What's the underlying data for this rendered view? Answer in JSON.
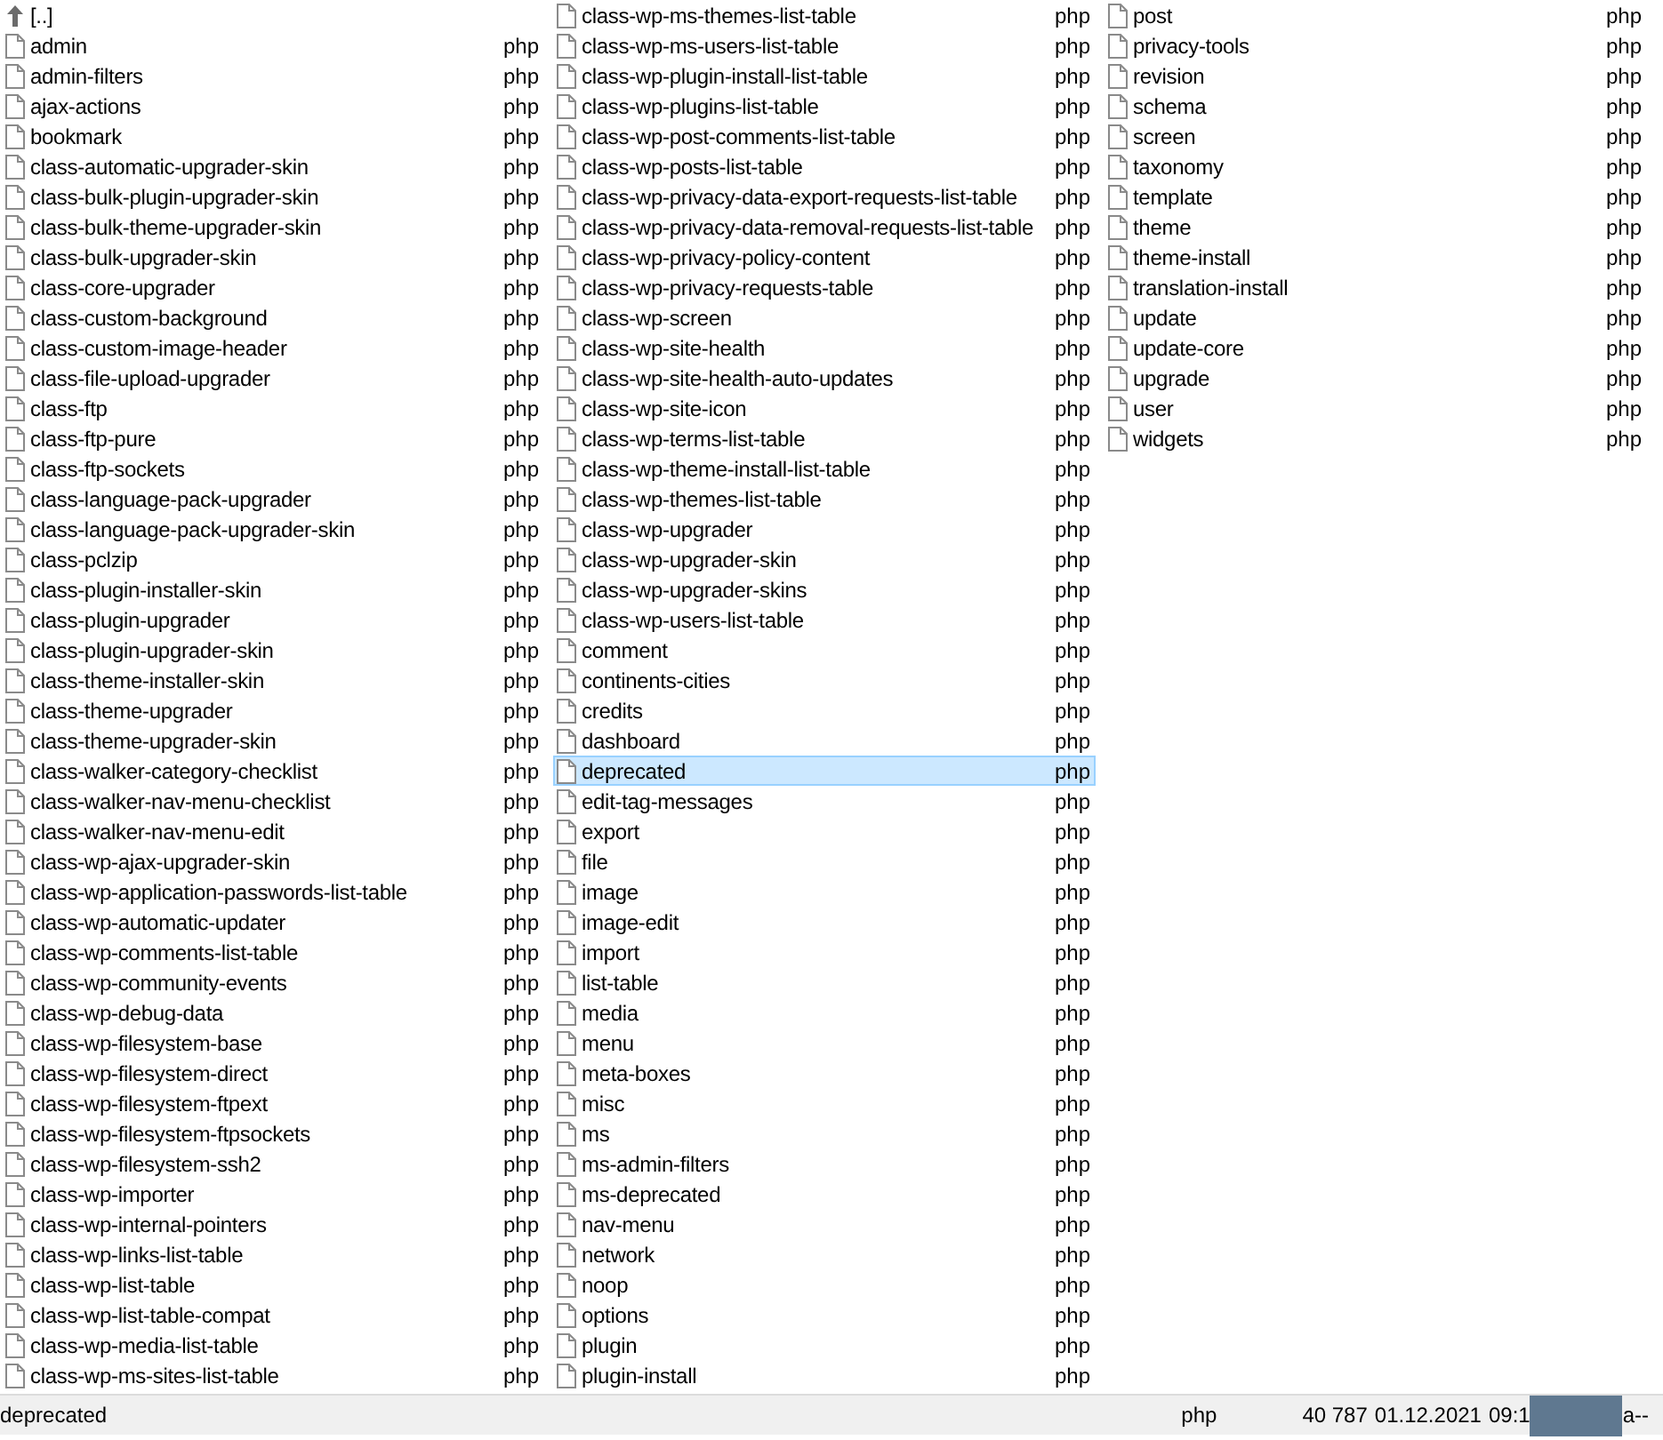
{
  "panel": {
    "columns": [
      {
        "items": [
          {
            "kind": "parent",
            "name": "[..]",
            "selected": false
          },
          {
            "kind": "file",
            "name": "admin",
            "ext": "php",
            "selected": false
          },
          {
            "kind": "file",
            "name": "admin-filters",
            "ext": "php",
            "selected": false
          },
          {
            "kind": "file",
            "name": "ajax-actions",
            "ext": "php",
            "selected": false
          },
          {
            "kind": "file",
            "name": "bookmark",
            "ext": "php",
            "selected": false
          },
          {
            "kind": "file",
            "name": "class-automatic-upgrader-skin",
            "ext": "php",
            "selected": false
          },
          {
            "kind": "file",
            "name": "class-bulk-plugin-upgrader-skin",
            "ext": "php",
            "selected": false
          },
          {
            "kind": "file",
            "name": "class-bulk-theme-upgrader-skin",
            "ext": "php",
            "selected": false
          },
          {
            "kind": "file",
            "name": "class-bulk-upgrader-skin",
            "ext": "php",
            "selected": false
          },
          {
            "kind": "file",
            "name": "class-core-upgrader",
            "ext": "php",
            "selected": false
          },
          {
            "kind": "file",
            "name": "class-custom-background",
            "ext": "php",
            "selected": false
          },
          {
            "kind": "file",
            "name": "class-custom-image-header",
            "ext": "php",
            "selected": false
          },
          {
            "kind": "file",
            "name": "class-file-upload-upgrader",
            "ext": "php",
            "selected": false
          },
          {
            "kind": "file",
            "name": "class-ftp",
            "ext": "php",
            "selected": false
          },
          {
            "kind": "file",
            "name": "class-ftp-pure",
            "ext": "php",
            "selected": false
          },
          {
            "kind": "file",
            "name": "class-ftp-sockets",
            "ext": "php",
            "selected": false
          },
          {
            "kind": "file",
            "name": "class-language-pack-upgrader",
            "ext": "php",
            "selected": false
          },
          {
            "kind": "file",
            "name": "class-language-pack-upgrader-skin",
            "ext": "php",
            "selected": false
          },
          {
            "kind": "file",
            "name": "class-pclzip",
            "ext": "php",
            "selected": false
          },
          {
            "kind": "file",
            "name": "class-plugin-installer-skin",
            "ext": "php",
            "selected": false
          },
          {
            "kind": "file",
            "name": "class-plugin-upgrader",
            "ext": "php",
            "selected": false
          },
          {
            "kind": "file",
            "name": "class-plugin-upgrader-skin",
            "ext": "php",
            "selected": false
          },
          {
            "kind": "file",
            "name": "class-theme-installer-skin",
            "ext": "php",
            "selected": false
          },
          {
            "kind": "file",
            "name": "class-theme-upgrader",
            "ext": "php",
            "selected": false
          },
          {
            "kind": "file",
            "name": "class-theme-upgrader-skin",
            "ext": "php",
            "selected": false
          },
          {
            "kind": "file",
            "name": "class-walker-category-checklist",
            "ext": "php",
            "selected": false
          },
          {
            "kind": "file",
            "name": "class-walker-nav-menu-checklist",
            "ext": "php",
            "selected": false
          },
          {
            "kind": "file",
            "name": "class-walker-nav-menu-edit",
            "ext": "php",
            "selected": false
          },
          {
            "kind": "file",
            "name": "class-wp-ajax-upgrader-skin",
            "ext": "php",
            "selected": false
          },
          {
            "kind": "file",
            "name": "class-wp-application-passwords-list-table",
            "ext": "php",
            "selected": false
          },
          {
            "kind": "file",
            "name": "class-wp-automatic-updater",
            "ext": "php",
            "selected": false
          },
          {
            "kind": "file",
            "name": "class-wp-comments-list-table",
            "ext": "php",
            "selected": false
          },
          {
            "kind": "file",
            "name": "class-wp-community-events",
            "ext": "php",
            "selected": false
          },
          {
            "kind": "file",
            "name": "class-wp-debug-data",
            "ext": "php",
            "selected": false
          },
          {
            "kind": "file",
            "name": "class-wp-filesystem-base",
            "ext": "php",
            "selected": false
          },
          {
            "kind": "file",
            "name": "class-wp-filesystem-direct",
            "ext": "php",
            "selected": false
          },
          {
            "kind": "file",
            "name": "class-wp-filesystem-ftpext",
            "ext": "php",
            "selected": false
          },
          {
            "kind": "file",
            "name": "class-wp-filesystem-ftpsockets",
            "ext": "php",
            "selected": false
          },
          {
            "kind": "file",
            "name": "class-wp-filesystem-ssh2",
            "ext": "php",
            "selected": false
          },
          {
            "kind": "file",
            "name": "class-wp-importer",
            "ext": "php",
            "selected": false
          },
          {
            "kind": "file",
            "name": "class-wp-internal-pointers",
            "ext": "php",
            "selected": false
          },
          {
            "kind": "file",
            "name": "class-wp-links-list-table",
            "ext": "php",
            "selected": false
          },
          {
            "kind": "file",
            "name": "class-wp-list-table",
            "ext": "php",
            "selected": false
          },
          {
            "kind": "file",
            "name": "class-wp-list-table-compat",
            "ext": "php",
            "selected": false
          },
          {
            "kind": "file",
            "name": "class-wp-media-list-table",
            "ext": "php",
            "selected": false
          },
          {
            "kind": "file",
            "name": "class-wp-ms-sites-list-table",
            "ext": "php",
            "selected": false
          }
        ]
      },
      {
        "items": [
          {
            "kind": "file",
            "name": "class-wp-ms-themes-list-table",
            "ext": "php",
            "selected": false
          },
          {
            "kind": "file",
            "name": "class-wp-ms-users-list-table",
            "ext": "php",
            "selected": false
          },
          {
            "kind": "file",
            "name": "class-wp-plugin-install-list-table",
            "ext": "php",
            "selected": false
          },
          {
            "kind": "file",
            "name": "class-wp-plugins-list-table",
            "ext": "php",
            "selected": false
          },
          {
            "kind": "file",
            "name": "class-wp-post-comments-list-table",
            "ext": "php",
            "selected": false
          },
          {
            "kind": "file",
            "name": "class-wp-posts-list-table",
            "ext": "php",
            "selected": false
          },
          {
            "kind": "file",
            "name": "class-wp-privacy-data-export-requests-list-table",
            "ext": "php",
            "selected": false
          },
          {
            "kind": "file",
            "name": "class-wp-privacy-data-removal-requests-list-table",
            "ext": "php",
            "selected": false
          },
          {
            "kind": "file",
            "name": "class-wp-privacy-policy-content",
            "ext": "php",
            "selected": false
          },
          {
            "kind": "file",
            "name": "class-wp-privacy-requests-table",
            "ext": "php",
            "selected": false
          },
          {
            "kind": "file",
            "name": "class-wp-screen",
            "ext": "php",
            "selected": false
          },
          {
            "kind": "file",
            "name": "class-wp-site-health",
            "ext": "php",
            "selected": false
          },
          {
            "kind": "file",
            "name": "class-wp-site-health-auto-updates",
            "ext": "php",
            "selected": false
          },
          {
            "kind": "file",
            "name": "class-wp-site-icon",
            "ext": "php",
            "selected": false
          },
          {
            "kind": "file",
            "name": "class-wp-terms-list-table",
            "ext": "php",
            "selected": false
          },
          {
            "kind": "file",
            "name": "class-wp-theme-install-list-table",
            "ext": "php",
            "selected": false
          },
          {
            "kind": "file",
            "name": "class-wp-themes-list-table",
            "ext": "php",
            "selected": false
          },
          {
            "kind": "file",
            "name": "class-wp-upgrader",
            "ext": "php",
            "selected": false
          },
          {
            "kind": "file",
            "name": "class-wp-upgrader-skin",
            "ext": "php",
            "selected": false
          },
          {
            "kind": "file",
            "name": "class-wp-upgrader-skins",
            "ext": "php",
            "selected": false
          },
          {
            "kind": "file",
            "name": "class-wp-users-list-table",
            "ext": "php",
            "selected": false
          },
          {
            "kind": "file",
            "name": "comment",
            "ext": "php",
            "selected": false
          },
          {
            "kind": "file",
            "name": "continents-cities",
            "ext": "php",
            "selected": false
          },
          {
            "kind": "file",
            "name": "credits",
            "ext": "php",
            "selected": false
          },
          {
            "kind": "file",
            "name": "dashboard",
            "ext": "php",
            "selected": false
          },
          {
            "kind": "file",
            "name": "deprecated",
            "ext": "php",
            "selected": true
          },
          {
            "kind": "file",
            "name": "edit-tag-messages",
            "ext": "php",
            "selected": false
          },
          {
            "kind": "file",
            "name": "export",
            "ext": "php",
            "selected": false
          },
          {
            "kind": "file",
            "name": "file",
            "ext": "php",
            "selected": false
          },
          {
            "kind": "file",
            "name": "image",
            "ext": "php",
            "selected": false
          },
          {
            "kind": "file",
            "name": "image-edit",
            "ext": "php",
            "selected": false
          },
          {
            "kind": "file",
            "name": "import",
            "ext": "php",
            "selected": false
          },
          {
            "kind": "file",
            "name": "list-table",
            "ext": "php",
            "selected": false
          },
          {
            "kind": "file",
            "name": "media",
            "ext": "php",
            "selected": false
          },
          {
            "kind": "file",
            "name": "menu",
            "ext": "php",
            "selected": false
          },
          {
            "kind": "file",
            "name": "meta-boxes",
            "ext": "php",
            "selected": false
          },
          {
            "kind": "file",
            "name": "misc",
            "ext": "php",
            "selected": false
          },
          {
            "kind": "file",
            "name": "ms",
            "ext": "php",
            "selected": false
          },
          {
            "kind": "file",
            "name": "ms-admin-filters",
            "ext": "php",
            "selected": false
          },
          {
            "kind": "file",
            "name": "ms-deprecated",
            "ext": "php",
            "selected": false
          },
          {
            "kind": "file",
            "name": "nav-menu",
            "ext": "php",
            "selected": false
          },
          {
            "kind": "file",
            "name": "network",
            "ext": "php",
            "selected": false
          },
          {
            "kind": "file",
            "name": "noop",
            "ext": "php",
            "selected": false
          },
          {
            "kind": "file",
            "name": "options",
            "ext": "php",
            "selected": false
          },
          {
            "kind": "file",
            "name": "plugin",
            "ext": "php",
            "selected": false
          },
          {
            "kind": "file",
            "name": "plugin-install",
            "ext": "php",
            "selected": false
          }
        ]
      },
      {
        "items": [
          {
            "kind": "file",
            "name": "post",
            "ext": "php",
            "selected": false
          },
          {
            "kind": "file",
            "name": "privacy-tools",
            "ext": "php",
            "selected": false
          },
          {
            "kind": "file",
            "name": "revision",
            "ext": "php",
            "selected": false
          },
          {
            "kind": "file",
            "name": "schema",
            "ext": "php",
            "selected": false
          },
          {
            "kind": "file",
            "name": "screen",
            "ext": "php",
            "selected": false
          },
          {
            "kind": "file",
            "name": "taxonomy",
            "ext": "php",
            "selected": false
          },
          {
            "kind": "file",
            "name": "template",
            "ext": "php",
            "selected": false
          },
          {
            "kind": "file",
            "name": "theme",
            "ext": "php",
            "selected": false
          },
          {
            "kind": "file",
            "name": "theme-install",
            "ext": "php",
            "selected": false
          },
          {
            "kind": "file",
            "name": "translation-install",
            "ext": "php",
            "selected": false
          },
          {
            "kind": "file",
            "name": "update",
            "ext": "php",
            "selected": false
          },
          {
            "kind": "file",
            "name": "update-core",
            "ext": "php",
            "selected": false
          },
          {
            "kind": "file",
            "name": "upgrade",
            "ext": "php",
            "selected": false
          },
          {
            "kind": "file",
            "name": "user",
            "ext": "php",
            "selected": false
          },
          {
            "kind": "file",
            "name": "widgets",
            "ext": "php",
            "selected": false
          }
        ]
      }
    ]
  },
  "status_bar": {
    "name": "deprecated",
    "ext": "php",
    "size": "40 787",
    "date": "01.12.2021",
    "time": "09:1",
    "attributes": "a--"
  }
}
